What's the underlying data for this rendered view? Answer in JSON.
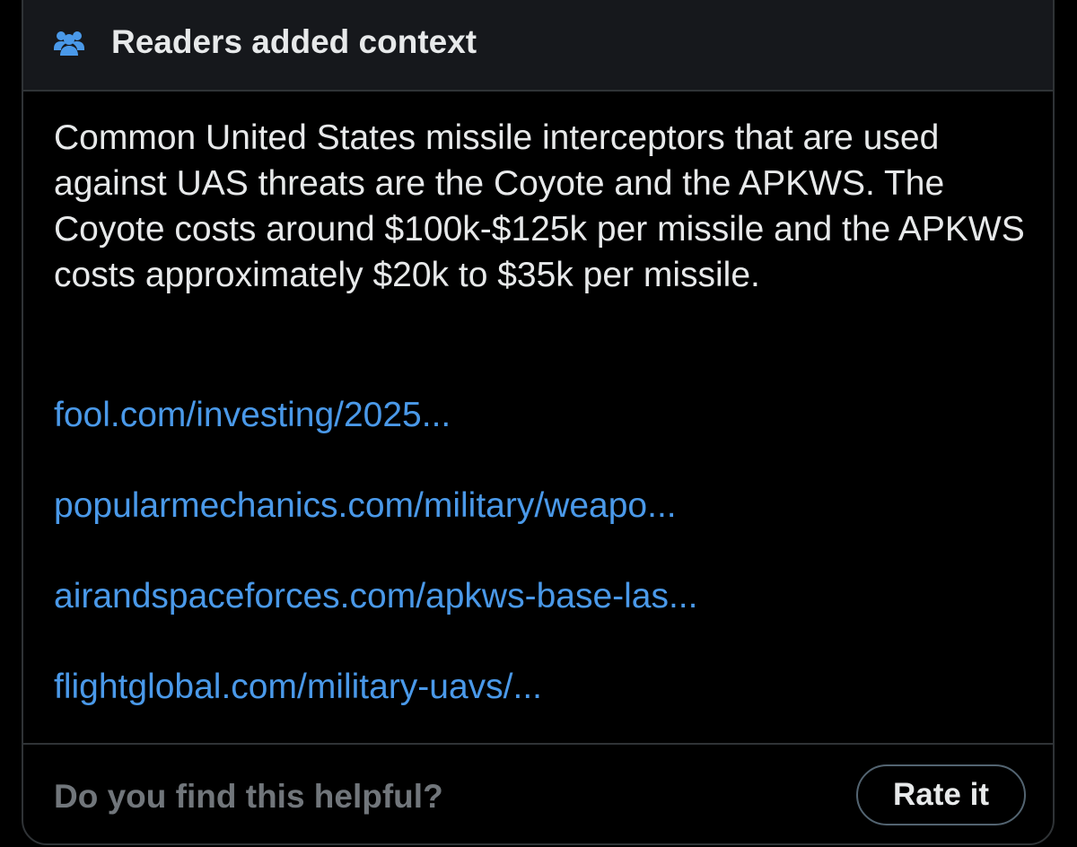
{
  "note": {
    "header": {
      "icon": "people-group-icon",
      "icon_color": "#4a99e9",
      "title": "Readers added context"
    },
    "body": "Common United States missile interceptors that are used against UAS threats are the Coyote and the APKWS. The Coyote costs around $100k-$125k per missile and the APKWS costs approximately $20k to $35k per missile.",
    "links": [
      "fool.com/investing/2025...",
      "popularmechanics.com/military/weapo...",
      "airandspaceforces.com/apkws-base-las...",
      "flightglobal.com/military-uavs/..."
    ],
    "link_color": "#4a99e9",
    "footer": {
      "question": "Do you find this helpful?",
      "rate_label": "Rate it"
    }
  }
}
